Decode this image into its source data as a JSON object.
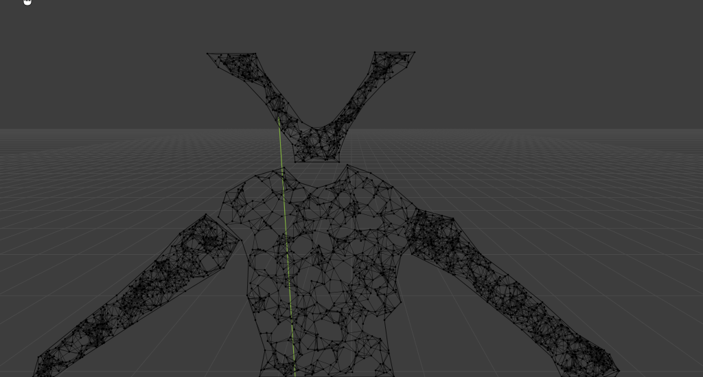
{
  "viewport": {
    "mode": "edit-mode-wireframe",
    "background_color": "#3d3d3d",
    "grid_line_color": "#4a4a4a",
    "mesh_edge_color": "#111111",
    "mesh_vertex_color": "#000000",
    "y_axis_color": "#7fae3f"
  },
  "cursor": {
    "icon": "hand-cursor-icon"
  }
}
